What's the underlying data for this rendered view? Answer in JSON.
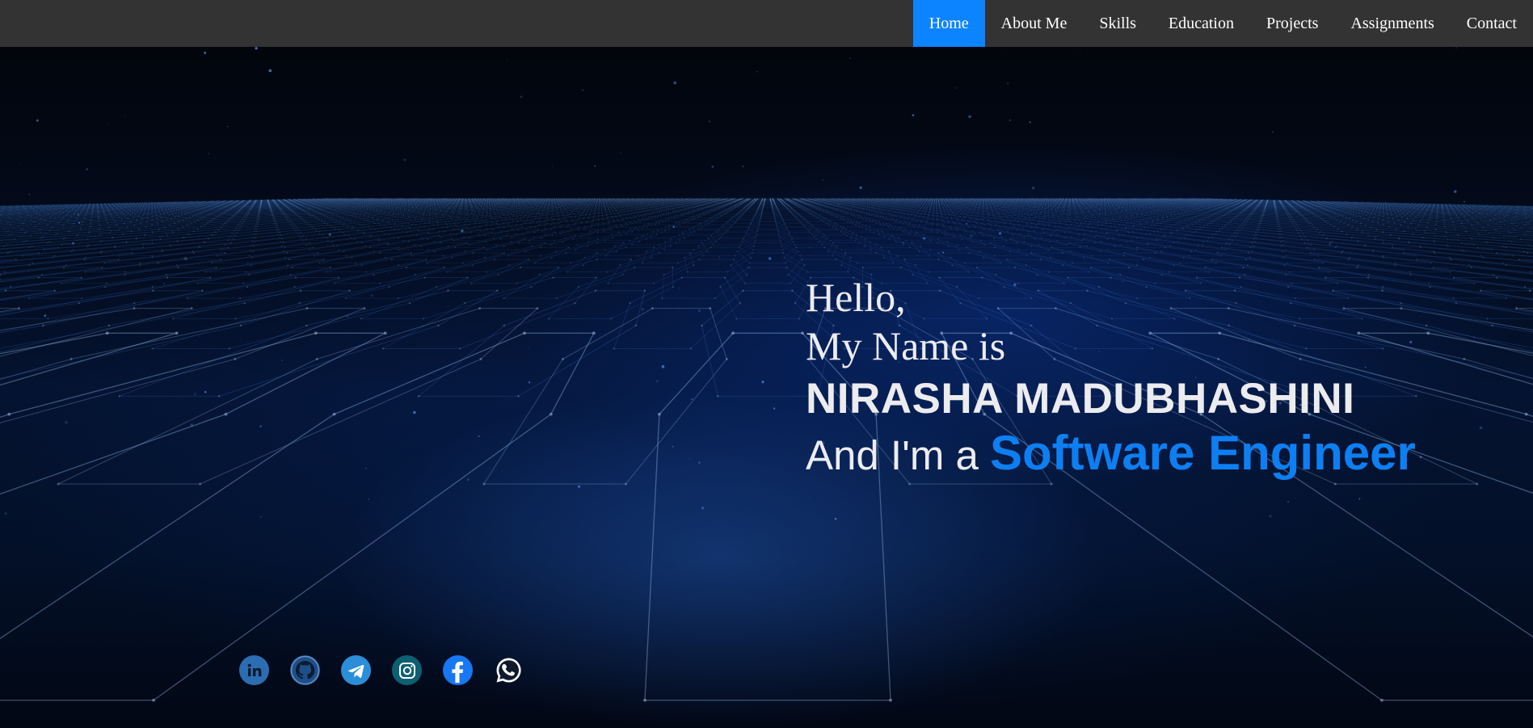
{
  "nav": {
    "items": [
      {
        "label": "Home",
        "active": true
      },
      {
        "label": "About Me",
        "active": false
      },
      {
        "label": "Skills",
        "active": false
      },
      {
        "label": "Education",
        "active": false
      },
      {
        "label": "Projects",
        "active": false
      },
      {
        "label": "Assignments",
        "active": false
      },
      {
        "label": "Contact",
        "active": false
      }
    ]
  },
  "hero": {
    "greeting_line1": "Hello,",
    "greeting_line2": "My Name is",
    "name": "NIRASHA MADUBHASHINI",
    "role_prefix": "And I'm a",
    "role": "Software Engineer"
  },
  "socials": [
    {
      "icon": "linkedin-icon"
    },
    {
      "icon": "github-icon"
    },
    {
      "icon": "telegram-icon"
    },
    {
      "icon": "instagram-icon"
    },
    {
      "icon": "facebook-icon"
    },
    {
      "icon": "whatsapp-icon"
    }
  ],
  "colors": {
    "navbar": "#333333",
    "active_nav": "#0d84ff",
    "accent": "#0d7ff2",
    "text": "#ececef",
    "background": "#020611"
  }
}
